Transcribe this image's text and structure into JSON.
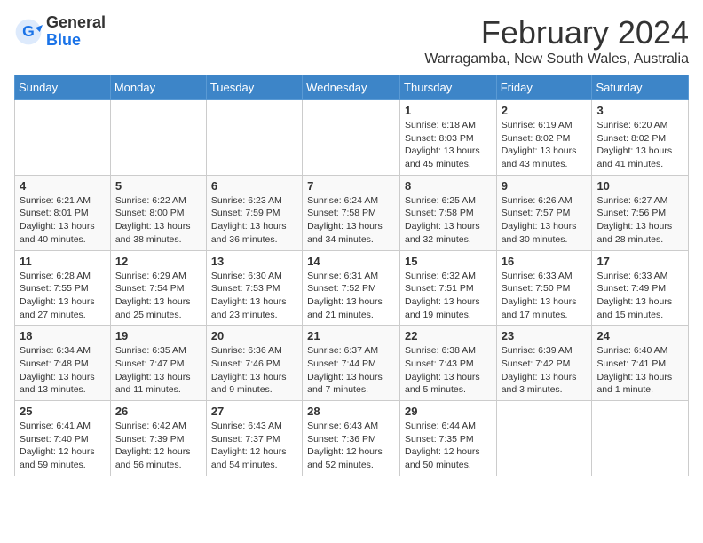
{
  "logo": {
    "general": "General",
    "blue": "Blue"
  },
  "title": "February 2024",
  "location": "Warragamba, New South Wales, Australia",
  "days_of_week": [
    "Sunday",
    "Monday",
    "Tuesday",
    "Wednesday",
    "Thursday",
    "Friday",
    "Saturday"
  ],
  "weeks": [
    [
      {
        "day": "",
        "info": ""
      },
      {
        "day": "",
        "info": ""
      },
      {
        "day": "",
        "info": ""
      },
      {
        "day": "",
        "info": ""
      },
      {
        "day": "1",
        "info": "Sunrise: 6:18 AM\nSunset: 8:03 PM\nDaylight: 13 hours\nand 45 minutes."
      },
      {
        "day": "2",
        "info": "Sunrise: 6:19 AM\nSunset: 8:02 PM\nDaylight: 13 hours\nand 43 minutes."
      },
      {
        "day": "3",
        "info": "Sunrise: 6:20 AM\nSunset: 8:02 PM\nDaylight: 13 hours\nand 41 minutes."
      }
    ],
    [
      {
        "day": "4",
        "info": "Sunrise: 6:21 AM\nSunset: 8:01 PM\nDaylight: 13 hours\nand 40 minutes."
      },
      {
        "day": "5",
        "info": "Sunrise: 6:22 AM\nSunset: 8:00 PM\nDaylight: 13 hours\nand 38 minutes."
      },
      {
        "day": "6",
        "info": "Sunrise: 6:23 AM\nSunset: 7:59 PM\nDaylight: 13 hours\nand 36 minutes."
      },
      {
        "day": "7",
        "info": "Sunrise: 6:24 AM\nSunset: 7:58 PM\nDaylight: 13 hours\nand 34 minutes."
      },
      {
        "day": "8",
        "info": "Sunrise: 6:25 AM\nSunset: 7:58 PM\nDaylight: 13 hours\nand 32 minutes."
      },
      {
        "day": "9",
        "info": "Sunrise: 6:26 AM\nSunset: 7:57 PM\nDaylight: 13 hours\nand 30 minutes."
      },
      {
        "day": "10",
        "info": "Sunrise: 6:27 AM\nSunset: 7:56 PM\nDaylight: 13 hours\nand 28 minutes."
      }
    ],
    [
      {
        "day": "11",
        "info": "Sunrise: 6:28 AM\nSunset: 7:55 PM\nDaylight: 13 hours\nand 27 minutes."
      },
      {
        "day": "12",
        "info": "Sunrise: 6:29 AM\nSunset: 7:54 PM\nDaylight: 13 hours\nand 25 minutes."
      },
      {
        "day": "13",
        "info": "Sunrise: 6:30 AM\nSunset: 7:53 PM\nDaylight: 13 hours\nand 23 minutes."
      },
      {
        "day": "14",
        "info": "Sunrise: 6:31 AM\nSunset: 7:52 PM\nDaylight: 13 hours\nand 21 minutes."
      },
      {
        "day": "15",
        "info": "Sunrise: 6:32 AM\nSunset: 7:51 PM\nDaylight: 13 hours\nand 19 minutes."
      },
      {
        "day": "16",
        "info": "Sunrise: 6:33 AM\nSunset: 7:50 PM\nDaylight: 13 hours\nand 17 minutes."
      },
      {
        "day": "17",
        "info": "Sunrise: 6:33 AM\nSunset: 7:49 PM\nDaylight: 13 hours\nand 15 minutes."
      }
    ],
    [
      {
        "day": "18",
        "info": "Sunrise: 6:34 AM\nSunset: 7:48 PM\nDaylight: 13 hours\nand 13 minutes."
      },
      {
        "day": "19",
        "info": "Sunrise: 6:35 AM\nSunset: 7:47 PM\nDaylight: 13 hours\nand 11 minutes."
      },
      {
        "day": "20",
        "info": "Sunrise: 6:36 AM\nSunset: 7:46 PM\nDaylight: 13 hours\nand 9 minutes."
      },
      {
        "day": "21",
        "info": "Sunrise: 6:37 AM\nSunset: 7:44 PM\nDaylight: 13 hours\nand 7 minutes."
      },
      {
        "day": "22",
        "info": "Sunrise: 6:38 AM\nSunset: 7:43 PM\nDaylight: 13 hours\nand 5 minutes."
      },
      {
        "day": "23",
        "info": "Sunrise: 6:39 AM\nSunset: 7:42 PM\nDaylight: 13 hours\nand 3 minutes."
      },
      {
        "day": "24",
        "info": "Sunrise: 6:40 AM\nSunset: 7:41 PM\nDaylight: 13 hours\nand 1 minute."
      }
    ],
    [
      {
        "day": "25",
        "info": "Sunrise: 6:41 AM\nSunset: 7:40 PM\nDaylight: 12 hours\nand 59 minutes."
      },
      {
        "day": "26",
        "info": "Sunrise: 6:42 AM\nSunset: 7:39 PM\nDaylight: 12 hours\nand 56 minutes."
      },
      {
        "day": "27",
        "info": "Sunrise: 6:43 AM\nSunset: 7:37 PM\nDaylight: 12 hours\nand 54 minutes."
      },
      {
        "day": "28",
        "info": "Sunrise: 6:43 AM\nSunset: 7:36 PM\nDaylight: 12 hours\nand 52 minutes."
      },
      {
        "day": "29",
        "info": "Sunrise: 6:44 AM\nSunset: 7:35 PM\nDaylight: 12 hours\nand 50 minutes."
      },
      {
        "day": "",
        "info": ""
      },
      {
        "day": "",
        "info": ""
      }
    ]
  ]
}
